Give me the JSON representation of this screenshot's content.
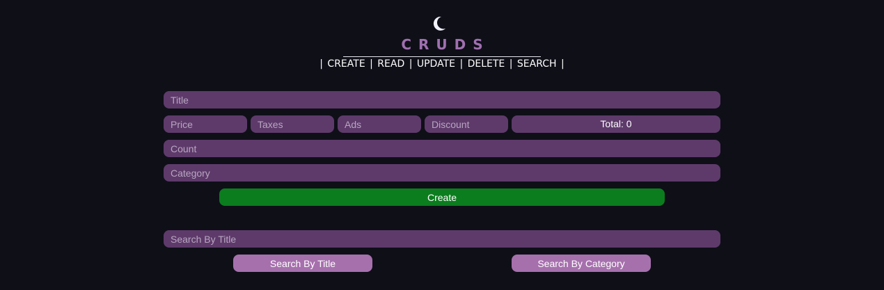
{
  "header": {
    "icon": "moon-icon",
    "brand": "CRUDS",
    "nav": {
      "create": "CREATE",
      "read": "READ",
      "update": "UPDATE",
      "delete": "DELETE",
      "search": "SEARCH",
      "separator": "|"
    }
  },
  "form": {
    "title_placeholder": "Title",
    "price_placeholder": "Price",
    "taxes_placeholder": "Taxes",
    "ads_placeholder": "Ads",
    "discount_placeholder": "Discount",
    "total_label": "Total: 0",
    "count_placeholder": "Count",
    "category_placeholder": "Category",
    "create_label": "Create"
  },
  "search": {
    "input_placeholder": "Search By Title",
    "by_title_label": "Search By Title",
    "by_category_label": "Search By Category"
  },
  "colors": {
    "background": "#0f0f18",
    "input_bg": "#5e3a6b",
    "brand": "#a070b0",
    "create_button": "#0b7d1e",
    "search_button": "#a670ad"
  }
}
